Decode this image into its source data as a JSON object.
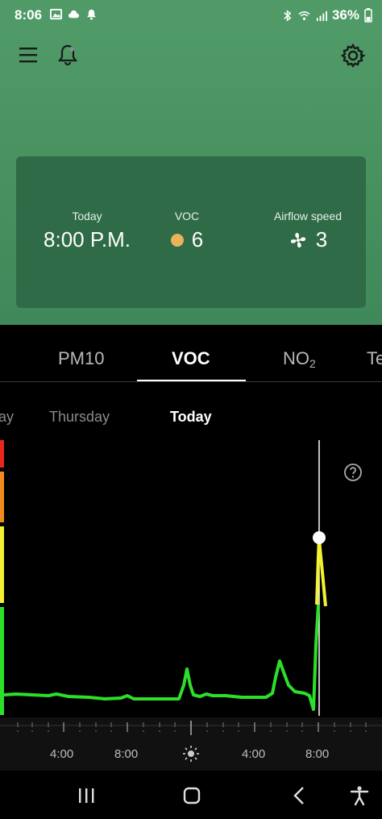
{
  "status_bar": {
    "time": "8:06",
    "battery": "36%"
  },
  "header": {
    "icons": [
      "menu-icon",
      "bell-icon",
      "gear-icon"
    ]
  },
  "summary": {
    "day_label": "Today",
    "time_value": "8:00 P.M.",
    "voc_label": "VOC",
    "voc_value": "6",
    "airflow_label": "Airflow speed",
    "airflow_value": "3"
  },
  "tabs": {
    "items": [
      "PM10",
      "VOC",
      "NO",
      "Te"
    ],
    "no2_subscript": "2",
    "active": "VOC"
  },
  "days": {
    "prev_partial": "ay",
    "thursday": "Thursday",
    "today": "Today"
  },
  "time_axis": {
    "labels": [
      "4:00",
      "8:00",
      "4:00",
      "8:00"
    ]
  },
  "colors": {
    "header_green": "#4f9a66",
    "card_green": "#2f6b47",
    "voc_dot": "#e9b35a",
    "line_green": "#2ce02a",
    "line_yellow": "#f2f232"
  }
}
